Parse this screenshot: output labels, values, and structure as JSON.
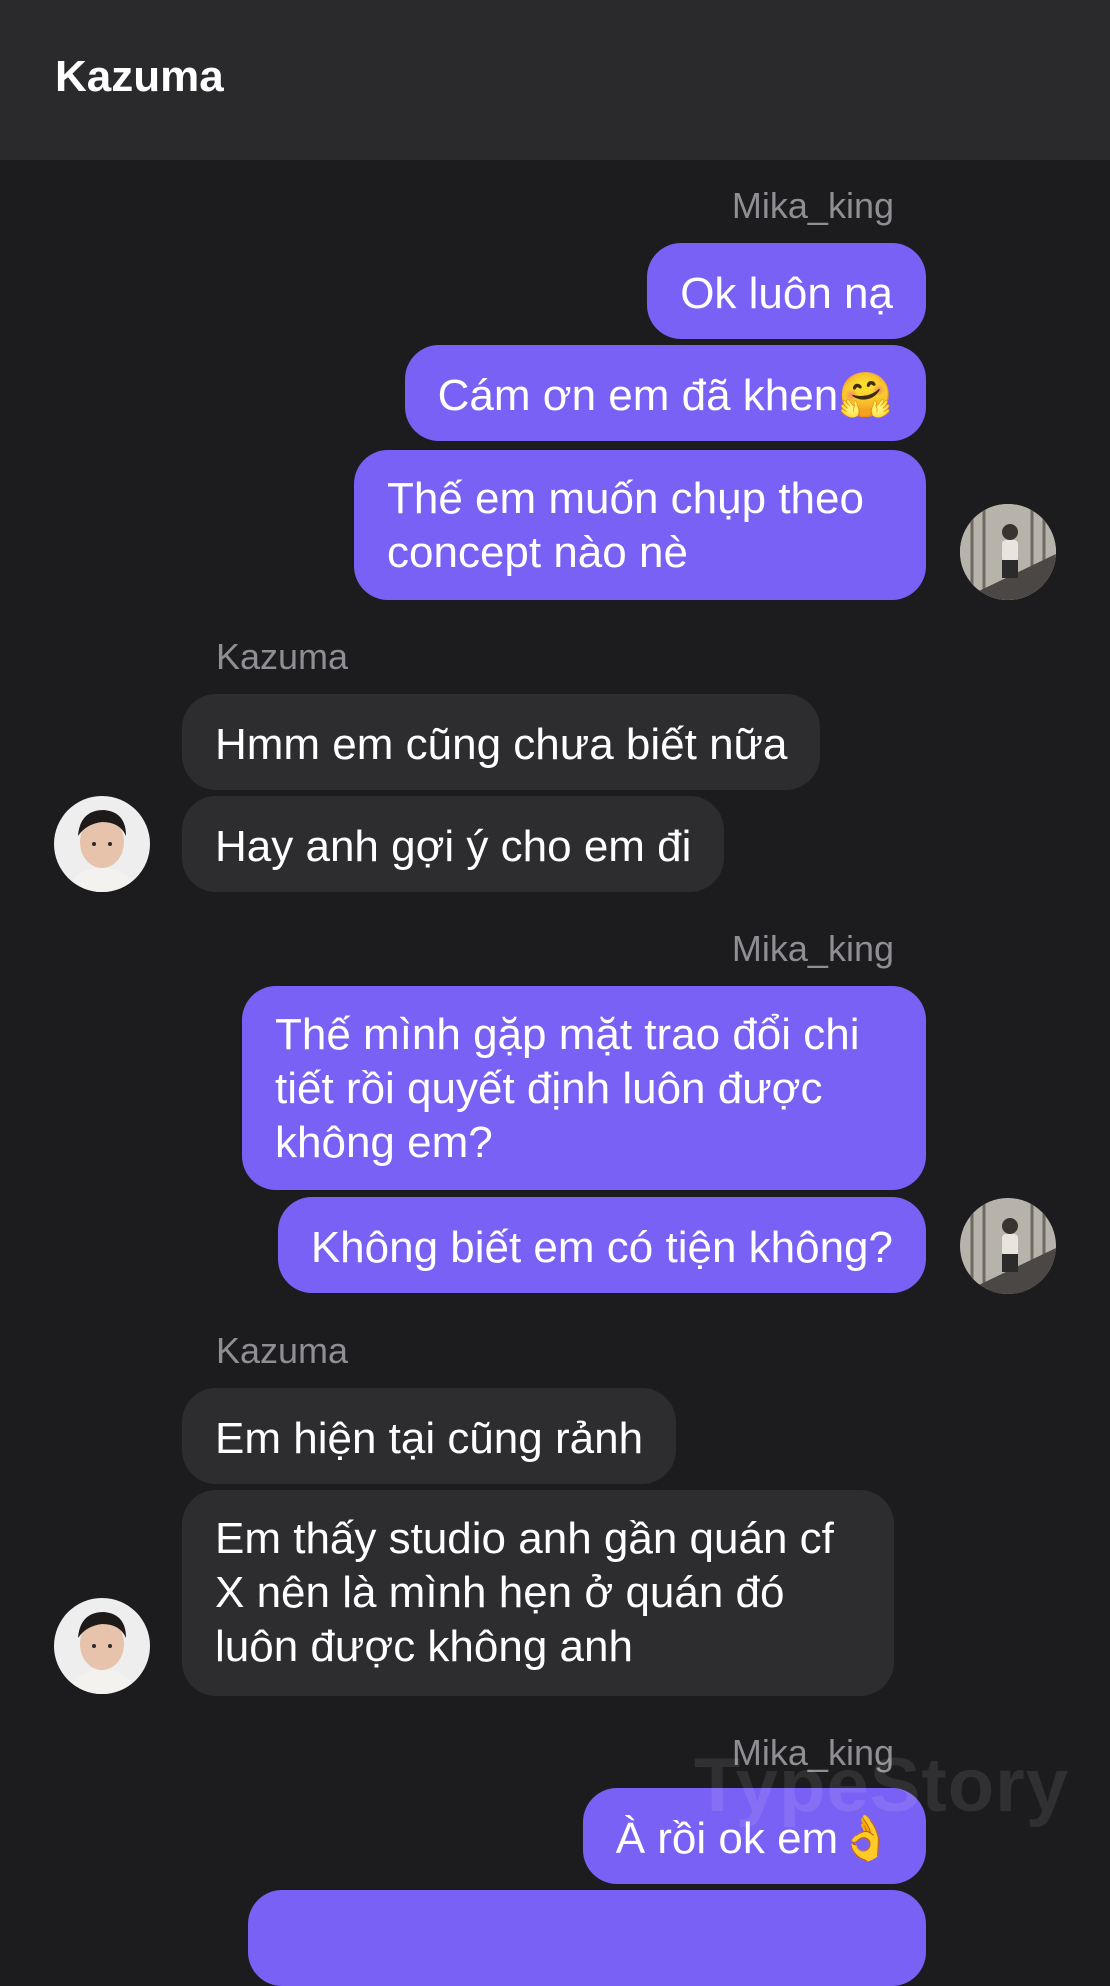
{
  "header": {
    "title": "Kazuma"
  },
  "groups": [
    {
      "sender": "Mika_king",
      "messages": [
        "Ok luôn nạ",
        "Cám ơn em đã khen🤗",
        "Thế em muốn chụp theo concept nào nè"
      ]
    },
    {
      "sender": "Kazuma",
      "messages": [
        "Hmm em cũng chưa biết nữa",
        "Hay anh gợi ý cho em đi"
      ]
    },
    {
      "sender": "Mika_king",
      "messages": [
        "Thế mình gặp mặt trao đổi chi tiết rồi quyết định luôn được không em?",
        "Không biết em có tiện không?"
      ]
    },
    {
      "sender": "Kazuma",
      "messages": [
        "Em hiện tại cũng rảnh",
        "Em thấy studio anh gần quán cf X nên là mình hẹn ở quán đó luôn được không anh"
      ]
    },
    {
      "sender": "Mika_king",
      "messages": [
        "À rồi ok em👌"
      ]
    }
  ],
  "watermark": "TypeStory",
  "colors": {
    "outgoing": "#7a61f5",
    "incoming": "#2d2d30",
    "background": "#1c1c1e",
    "header": "#2a2a2c"
  },
  "icons": {
    "my_avatar": "avatar-staircase-photo",
    "contact_avatar": "avatar-portrait-photo"
  }
}
